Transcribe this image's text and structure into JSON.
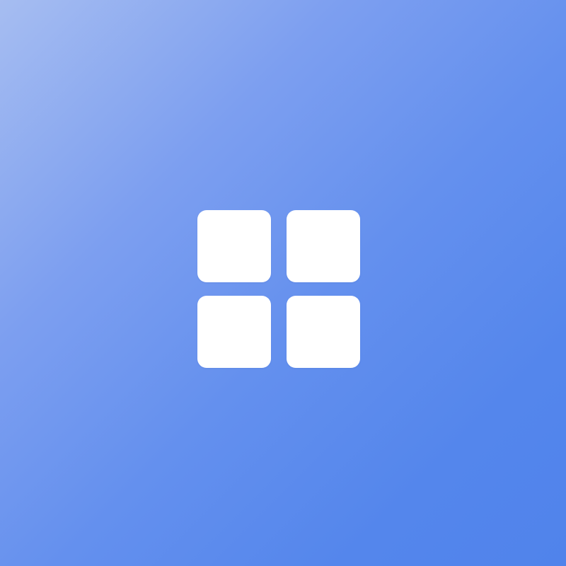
{
  "screen": {
    "background_gradient": [
      "#a6bdf1",
      "#7d9ff0",
      "#6490ee",
      "#5486ec",
      "#5083eb"
    ],
    "icon": {
      "name": "grid-apps-icon",
      "tile_color": "#ffffff",
      "tiles": 4
    }
  }
}
